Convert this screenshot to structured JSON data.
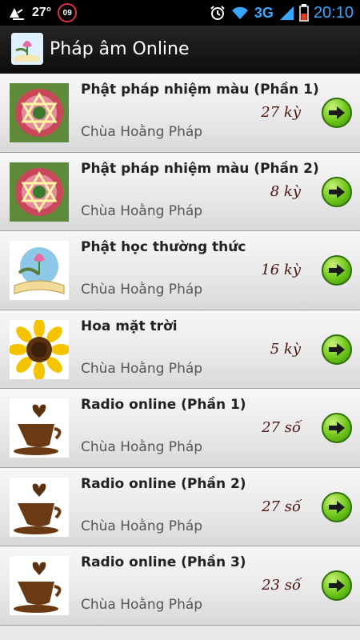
{
  "status_bar": {
    "temperature": "27°",
    "badge": "09",
    "network": "3G",
    "time": "20:10",
    "icons": [
      "weather-icon",
      "notification-badge-icon",
      "alarm-icon",
      "wifi-icon",
      "signal-icon",
      "battery-icon"
    ]
  },
  "app_bar": {
    "title": "Pháp âm Online",
    "logo_icon": "app-logo-icon"
  },
  "items": [
    {
      "title": "Phật pháp nhiệm màu (Phần 1)",
      "count": "27 kỳ",
      "subtitle": "Chùa Hoằng Pháp",
      "thumb": "lotus-mandala"
    },
    {
      "title": "Phật pháp nhiệm màu (Phần 2)",
      "count": "8 kỳ",
      "subtitle": "Chùa Hoằng Pháp",
      "thumb": "lotus-mandala"
    },
    {
      "title": "Phật học thường thức",
      "count": "16 kỳ",
      "subtitle": "Chùa Hoằng Pháp",
      "thumb": "open-book-lotus"
    },
    {
      "title": "Hoa mặt trời",
      "count": "5 kỳ",
      "subtitle": "Chùa Hoằng Pháp",
      "thumb": "sunflower"
    },
    {
      "title": "Radio online (Phần 1)",
      "count": "27 số",
      "subtitle": "Chùa Hoằng Pháp",
      "thumb": "coffee-cup"
    },
    {
      "title": "Radio online (Phần 2)",
      "count": "27 số",
      "subtitle": "Chùa Hoằng Pháp",
      "thumb": "coffee-cup"
    },
    {
      "title": "Radio online (Phần 3)",
      "count": "23 số",
      "subtitle": "Chùa Hoằng Pháp",
      "thumb": "coffee-cup"
    }
  ],
  "colors": {
    "accent_blue": "#3aa7ff",
    "button_green": "#6cc418",
    "count_text": "#4a1410"
  }
}
